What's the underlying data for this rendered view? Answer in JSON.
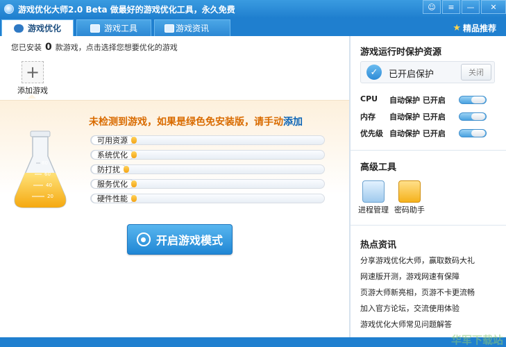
{
  "window": {
    "title": "游戏优化大师2.0 Beta 做最好的游戏优化工具，永久免费",
    "buttons": {
      "feedback": "☺",
      "menu": "≡",
      "minimize": "—",
      "close": "✕"
    }
  },
  "tabs": [
    {
      "label": "游戏优化",
      "icon": "gamepad-icon",
      "active": true
    },
    {
      "label": "游戏工具",
      "icon": "toolbox-icon",
      "active": false
    },
    {
      "label": "游戏资讯",
      "icon": "news-icon",
      "active": false
    }
  ],
  "recommend": {
    "label": "精品推荐",
    "icon": "star-icon"
  },
  "installed": {
    "prefix": "您已安装",
    "count": "0",
    "suffix": "款游戏，点击选择您想要优化的游戏"
  },
  "add_game": {
    "label": "添加游戏",
    "symbol": "+"
  },
  "notice": {
    "text": "未检测到游戏，如果是绿色免安装版，请手动",
    "link": "添加"
  },
  "optimize_items": [
    {
      "label": "可用资源",
      "level": 0.15
    },
    {
      "label": "系统优化",
      "level": 0.15
    },
    {
      "label": "防打扰",
      "level": 0.15
    },
    {
      "label": "服务优化",
      "level": 0.15
    },
    {
      "label": "硬件性能",
      "level": 0.15
    }
  ],
  "flask_marks": [
    "80",
    "60",
    "40",
    "20"
  ],
  "start_button": {
    "label": "开启游戏模式"
  },
  "protection": {
    "title": "游戏运行时保护资源",
    "status": "已开启保护",
    "off_label": "关闭",
    "resources": [
      {
        "name": "CPU",
        "status": "自动保护 已开启",
        "on": true
      },
      {
        "name": "内存",
        "status": "自动保护 已开启",
        "on": true
      },
      {
        "name": "优先级",
        "status": "自动保护 已开启",
        "on": true
      }
    ]
  },
  "advanced_tools": {
    "title": "高级工具",
    "items": [
      {
        "label": "进程管理",
        "icon": "process-manager-icon"
      },
      {
        "label": "密码助手",
        "icon": "password-key-icon"
      }
    ]
  },
  "hot_news": {
    "title": "热点资讯",
    "items": [
      "分享游戏优化大师，赢取数码大礼",
      "网速版开测，游戏网速有保障",
      "页游大师新亮相，页游不卡更流畅",
      "加入官方论坛，交流使用体验",
      "游戏优化大师常见问题解答"
    ]
  },
  "watermark": "华军下载站",
  "colors": {
    "accent": "#1f7fcf",
    "notice": "#d96b00",
    "link": "#0b64b6",
    "fill": "#f3a315"
  }
}
